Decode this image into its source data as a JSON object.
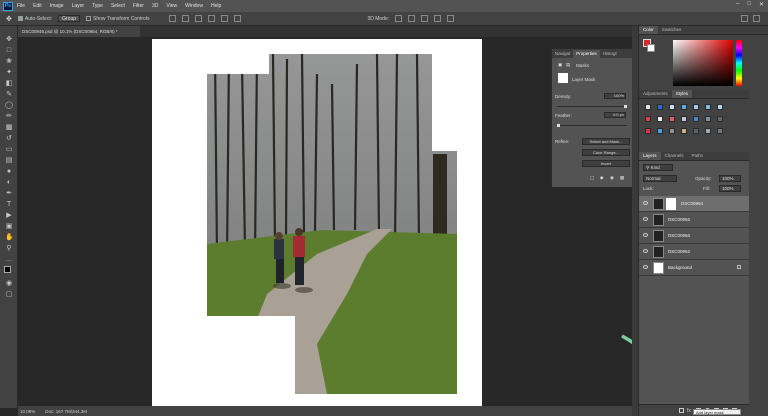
{
  "menubar": {
    "logo": "Ps",
    "items": [
      "File",
      "Edit",
      "Image",
      "Layer",
      "Type",
      "Select",
      "Filter",
      "3D",
      "View",
      "Window",
      "Help"
    ]
  },
  "options": {
    "auto_select_label": "Auto-Select:",
    "auto_select_value": "Group",
    "transform_label": "Show Transform Controls",
    "mode_label": "3D Mode:"
  },
  "document": {
    "tab_title": "DSC00946.psd @ 10.1% (DSC00954, RGB/8) *",
    "zoom": "10.08%",
    "doc_size": "Doc: 167.7M/344.3M"
  },
  "properties": {
    "tabs": [
      "Navigat",
      "Properties",
      "Histogr"
    ],
    "kind_label": "Masks",
    "mask_label": "Layer Mask",
    "density_label": "Density:",
    "density_value": "100%",
    "density_level": 1.0,
    "feather_label": "Feather:",
    "feather_value": "0.0 px",
    "feather_level": 0.0,
    "refine_label": "Refine:",
    "select_mask_button": "Select and Mask...",
    "color_range_button": "Color Range...",
    "invert_button": "Invert"
  },
  "color_panel": {
    "tabs": [
      "Color",
      "Swatches"
    ],
    "fg_color": "#d8262a"
  },
  "adjustments_panel": {
    "tabs": [
      "Adjustments",
      "Styles"
    ]
  },
  "layers_panel": {
    "tabs": [
      "Layers",
      "Channels",
      "Paths"
    ],
    "filter_label": "Kind",
    "blend_mode": "Normal",
    "opacity_label": "Opacity:",
    "opacity_value": "100%",
    "lock_label": "Lock:",
    "fill_label": "Fill:",
    "fill_value": "100%",
    "layers": [
      {
        "name": "DSC00954",
        "selected": true,
        "has_mask": true
      },
      {
        "name": "DSC00955",
        "selected": false,
        "has_mask": false
      },
      {
        "name": "DSC00956",
        "selected": false,
        "has_mask": false
      },
      {
        "name": "DSC00952",
        "selected": false,
        "has_mask": false
      },
      {
        "name": "Background",
        "selected": false,
        "has_mask": false,
        "locked": true
      }
    ],
    "tooltip": "Add layer mask"
  },
  "colors": {
    "accent": "#31a8ff",
    "arrow": "#7dcfa0"
  }
}
